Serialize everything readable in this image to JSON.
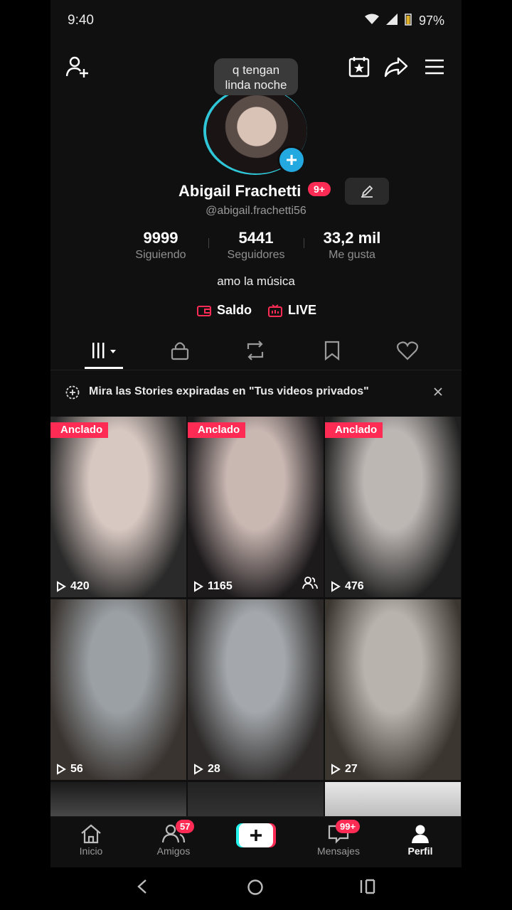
{
  "status": {
    "time": "9:40",
    "battery": "97%"
  },
  "tooltip": {
    "line1": "q tengan",
    "line2": "linda noche"
  },
  "profile": {
    "name": "Abigail Frachetti",
    "badge": "9+",
    "handle": "@abigail.frachetti56",
    "bio": "amo la música"
  },
  "stats": [
    {
      "num": "9999",
      "label": "Siguiendo"
    },
    {
      "num": "5441",
      "label": "Seguidores"
    },
    {
      "num": "33,2 mil",
      "label": "Me gusta"
    }
  ],
  "links": {
    "saldo": "Saldo",
    "live": "LIVE"
  },
  "notice": {
    "text": "Mira las Stories expiradas en \"Tus videos privados\""
  },
  "videos": [
    {
      "pinned": "Anclado",
      "views": "420",
      "colors": [
        "#d8c8c2",
        "#2a2a2a"
      ]
    },
    {
      "pinned": "Anclado",
      "views": "1165",
      "colors": [
        "#c9b7b2",
        "#1d1a1c"
      ]
    },
    {
      "pinned": "Anclado",
      "views": "476",
      "colors": [
        "#bdb7b4",
        "#202020"
      ]
    },
    {
      "pinned": "",
      "views": "56",
      "colors": [
        "#9aa0a4",
        "#3a3430"
      ]
    },
    {
      "pinned": "",
      "views": "28",
      "colors": [
        "#a4a8ac",
        "#2d2a29"
      ]
    },
    {
      "pinned": "",
      "views": "27",
      "colors": [
        "#b9b3ad",
        "#3c3631"
      ]
    }
  ],
  "nav": {
    "inicio": "Inicio",
    "amigos": "Amigos",
    "amigos_badge": "57",
    "mensajes": "Mensajes",
    "mensajes_badge": "99+",
    "perfil": "Perfil"
  },
  "accent": "#fe2c55",
  "ring_color": "#2fc6d8"
}
